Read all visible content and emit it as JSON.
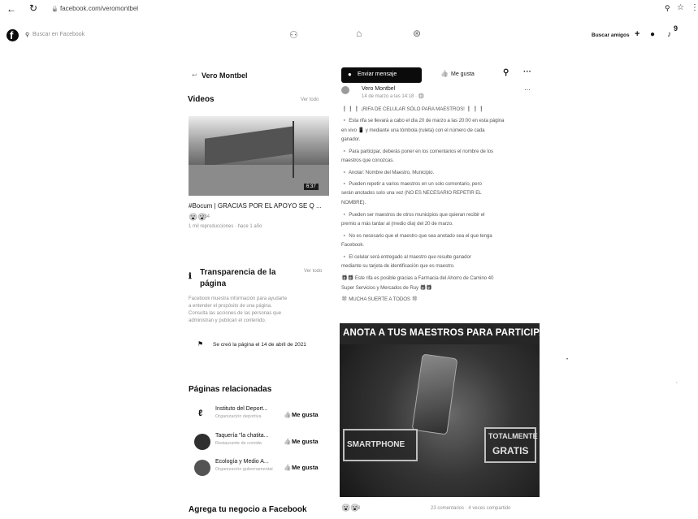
{
  "browser": {
    "url": "facebook.com/veromontbel",
    "back_icon": "arrow-left-icon",
    "reload_icon": "reload-icon",
    "zoom_icon": "search-icon",
    "star_icon": "star-icon"
  },
  "fb_header": {
    "search_placeholder": "Buscar en Facebook",
    "find_friends_label": "Buscar amigos",
    "plus_label": "+",
    "notif_count": "9"
  },
  "page": {
    "name": "Vero Montbel"
  },
  "actions": {
    "message_label": "Enviar mensaje",
    "like_label": "Me gusta",
    "more_label": "···"
  },
  "videos": {
    "title": "Videos",
    "see_all": "Ver todo",
    "duration": "6:37",
    "video_title": "#Bocum | GRACIAS POR EL APOYO SE Q ...",
    "reactions_count": "134",
    "meta": "1 mil reproducciones · hace 1 año"
  },
  "transparency": {
    "title_line1": "Transparencia de la",
    "title_line2": "página",
    "see_all": "Ver todo",
    "desc_line1": "Facebook muestra información para ayudarte",
    "desc_line2": "a entender el propósito de una página.",
    "desc_line3": "Consulta las acciones de las personas que",
    "desc_line4": "administran y publican el contenido.",
    "created_text": "Se creó la página el 14 de abril de 2021"
  },
  "related": {
    "title": "Páginas relacionadas",
    "items": [
      {
        "name": "Instituto del Deport...",
        "category": "Organización deportiva",
        "like": "Me gusta"
      },
      {
        "name": "Taquería \"la chatita...",
        "category": "Restaurante de comida",
        "like": "Me gusta"
      },
      {
        "name": "Ecología y Medio A...",
        "category": "Organización gubernamental",
        "like": "Me gusta"
      }
    ]
  },
  "footer_left": {
    "title": "Agrega tu negocio a Facebook"
  },
  "post": {
    "author": "Vero Montbel",
    "time": "14 de marzo a las 14:18 · 🌐",
    "more": "···",
    "lines": [
      "❗❗❗ ¡RIFA DE CELULAR SÓLO PARA MAESTROS! ❗❗❗",
      "🔸 Esta rifa se llevará a cabo el día 20 de marzo a las 20:00 en esta página",
      "en vivo 📱 y mediante una tómbola (ruleta) con el número de cada",
      "ganador.",
      "🔸 Para participar, deberás poner en los comentarios el nombre de los",
      "maestros que conozcas.",
      "🔸 Anotar: Nombre del Maestro, Municipio.",
      "🔸 Pueden repetir a varios maestros en un solo comentario, pero",
      "serán anotados solo una vez (NO ES NECESARIO REPETIR EL",
      "NOMBRE).",
      "🔸 Pueden ser maestros de otros municipios que quieran recibir el",
      "premio a más tardar al (medio día) del 20 de marzo.",
      "🔸 No es necesario que el maestro que sea anotado sea el que tenga",
      "Facebook.",
      "🔸 El celular será entregado al maestro que resulte ganador",
      "mediante su tarjeta de identificación que es maestro.",
      "🎁🎁 Este rifa es posible gracias a Farmacia del Ahorro de Camino 40",
      "Super Servicios y Mercados de Ruy 🎁🎁",
      "🍀 MUCHA SUERTE A TODOS 🍀"
    ],
    "image_headline": "ANOTA A TUS MAESTROS PARA PARTICIPAR",
    "image_left_text": "SMARTPHONE",
    "image_right_line1": "TOTALMENTE",
    "image_right_line2": "GRATIS",
    "reaction_count": "8",
    "stats": "23 comentarios · 4 veces compartido"
  }
}
